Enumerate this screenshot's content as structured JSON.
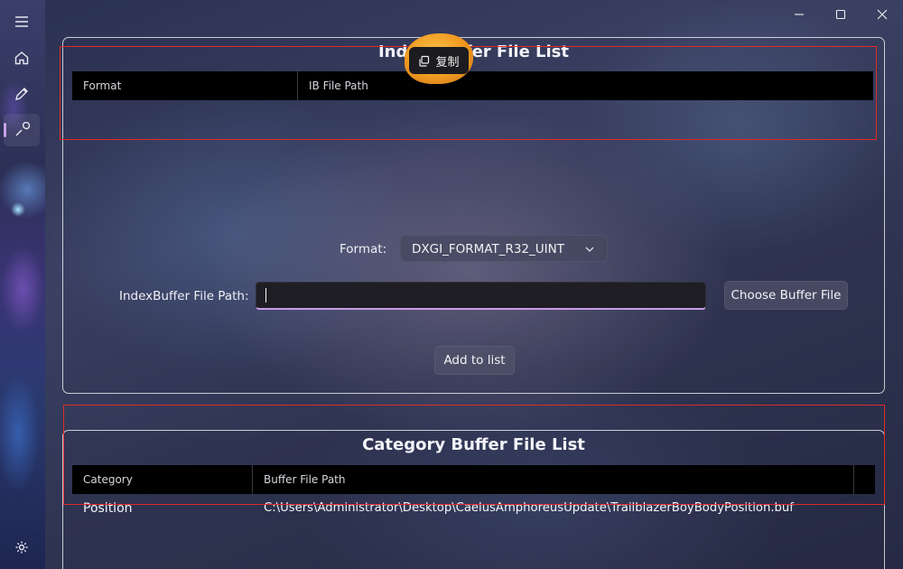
{
  "nav": {
    "items": [
      {
        "name": "menu",
        "icon": "hamburger-menu-icon"
      },
      {
        "name": "home",
        "icon": "home-icon"
      },
      {
        "name": "edit",
        "icon": "pencil-icon"
      },
      {
        "name": "tools",
        "icon": "wrench-icon",
        "active": true
      },
      {
        "name": "settings",
        "icon": "gear-icon"
      }
    ]
  },
  "window": {
    "controls": [
      "minimize-icon",
      "maximize-icon",
      "close-icon"
    ]
  },
  "index_buffer_card": {
    "title": "Index Buffer File List",
    "columns": [
      "Format",
      "IB File Path"
    ],
    "format_label": "Format:",
    "format_value": "DXGI_FORMAT_R32_UINT",
    "path_label": "IndexBuffer File Path:",
    "path_value": "",
    "choose_button": "Choose Buffer File",
    "add_button": "Add to list"
  },
  "category_buffer_card": {
    "title": "Category Buffer File List",
    "columns": [
      "Category",
      "Buffer File Path"
    ],
    "rows": [
      {
        "category": "Position",
        "path": "C:\\Users\\Administrator\\Desktop\\CaelusAmphoreusUpdate\\TrailblazerBoyBodyPosition.buf"
      }
    ]
  },
  "copy_popup": {
    "label": "复制",
    "icon": "copy-icon"
  },
  "colors": {
    "accent": "#c89ce8",
    "annotation_frame": "#e02a2a",
    "grid_header": "#000000"
  }
}
